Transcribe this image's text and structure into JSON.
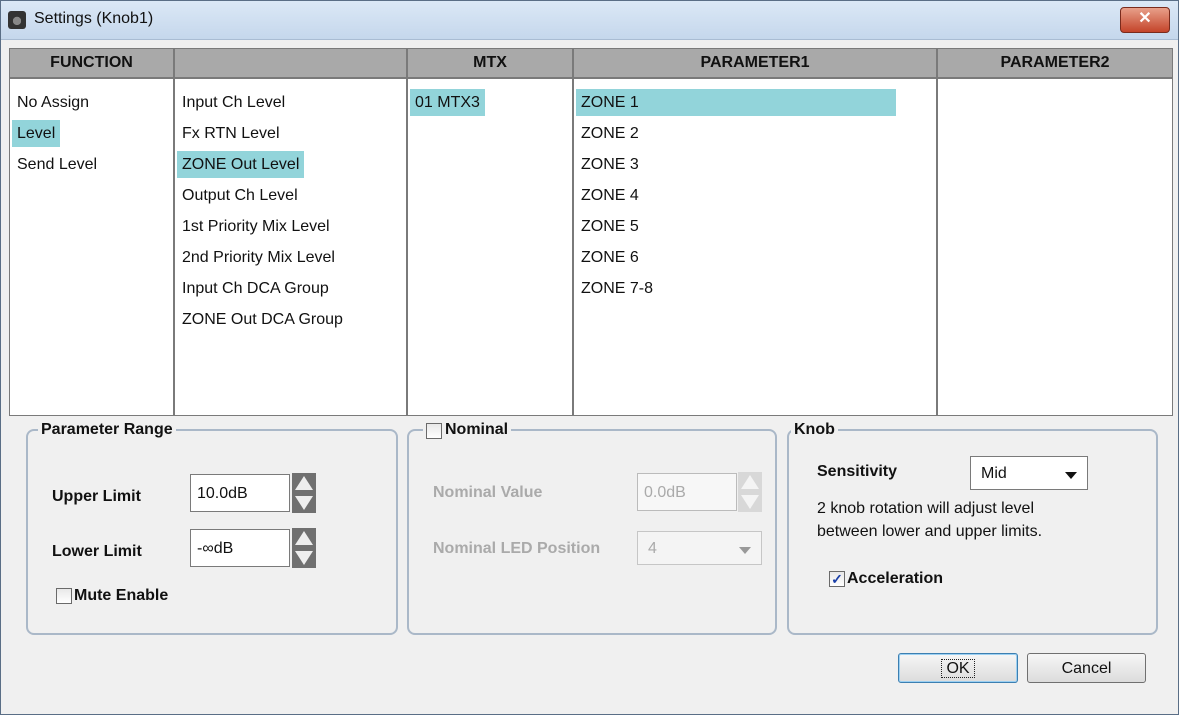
{
  "window": {
    "title": "Settings (Knob1)",
    "close_glyph": "✕"
  },
  "grid": {
    "function": {
      "header": "FUNCTION",
      "items": [
        "No Assign",
        "Level",
        "Send Level"
      ],
      "selected": "Level"
    },
    "subfunction": {
      "header": "",
      "items": [
        "Input Ch Level",
        "Fx RTN Level",
        "ZONE Out Level",
        "Output Ch Level",
        "1st Priority Mix Level",
        "2nd Priority Mix Level",
        "Input Ch DCA Group",
        "ZONE Out DCA Group"
      ],
      "selected": "ZONE Out Level"
    },
    "mtx": {
      "header": "MTX",
      "items": [
        "01 MTX3"
      ],
      "selected": "01 MTX3"
    },
    "parameter1": {
      "header": "PARAMETER1",
      "items": [
        "ZONE 1",
        "ZONE 2",
        "ZONE 3",
        "ZONE 4",
        "ZONE 5",
        "ZONE 6",
        "ZONE 7-8"
      ],
      "selected": "ZONE 1"
    },
    "parameter2": {
      "header": "PARAMETER2",
      "items": []
    },
    "highlight_color": "#92d4da"
  },
  "parameter_range": {
    "title": "Parameter Range",
    "upper_label": "Upper Limit",
    "upper_value": "10.0dB",
    "lower_label": "Lower Limit",
    "lower_value": "-∞dB",
    "mute_label": "Mute Enable",
    "mute_checked": false
  },
  "nominal": {
    "title": "Nominal",
    "checked": false,
    "value_label": "Nominal Value",
    "value": "0.0dB",
    "led_label": "Nominal LED Position",
    "led_value": "4"
  },
  "knob": {
    "title": "Knob",
    "sensitivity_label": "Sensitivity",
    "sensitivity_value": "Mid",
    "note_line1": "2 knob rotation will adjust level",
    "note_line2": "between lower and upper limits.",
    "acceleration_label": "Acceleration",
    "acceleration_checked": true
  },
  "buttons": {
    "ok": "OK",
    "cancel": "Cancel"
  }
}
